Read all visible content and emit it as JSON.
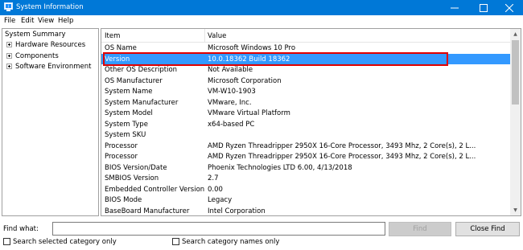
{
  "window": {
    "title": "System Information",
    "accent": "#0078d7"
  },
  "menu": [
    "File",
    "Edit",
    "View",
    "Help"
  ],
  "tree": {
    "root": "System Summary",
    "children": [
      "Hardware Resources",
      "Components",
      "Software Environment"
    ]
  },
  "table": {
    "headers": {
      "item": "Item",
      "value": "Value"
    },
    "selected_index": 1,
    "rows": [
      {
        "item": "OS Name",
        "value": "Microsoft Windows 10 Pro"
      },
      {
        "item": "Version",
        "value": "10.0.18362 Build 18362"
      },
      {
        "item": "Other OS Description",
        "value": "Not Available"
      },
      {
        "item": "OS Manufacturer",
        "value": "Microsoft Corporation"
      },
      {
        "item": "System Name",
        "value": "VM-W10-1903"
      },
      {
        "item": "System Manufacturer",
        "value": "VMware, Inc."
      },
      {
        "item": "System Model",
        "value": "VMware Virtual Platform"
      },
      {
        "item": "System Type",
        "value": "x64-based PC"
      },
      {
        "item": "System SKU",
        "value": ""
      },
      {
        "item": "Processor",
        "value": "AMD Ryzen Threadripper 2950X 16-Core Processor, 3493 Mhz, 2 Core(s), 2 L..."
      },
      {
        "item": "Processor",
        "value": "AMD Ryzen Threadripper 2950X 16-Core Processor, 3493 Mhz, 2 Core(s), 2 L..."
      },
      {
        "item": "BIOS Version/Date",
        "value": "Phoenix Technologies LTD 6.00, 4/13/2018"
      },
      {
        "item": "SMBIOS Version",
        "value": "2.7"
      },
      {
        "item": "Embedded Controller Version",
        "value": "0.00"
      },
      {
        "item": "BIOS Mode",
        "value": "Legacy"
      },
      {
        "item": "BaseBoard Manufacturer",
        "value": "Intel Corporation"
      }
    ]
  },
  "find": {
    "label": "Find what:",
    "value": "",
    "find_button": "Find",
    "close_button": "Close Find",
    "search_selected": "Search selected category only",
    "search_names": "Search category names only"
  }
}
